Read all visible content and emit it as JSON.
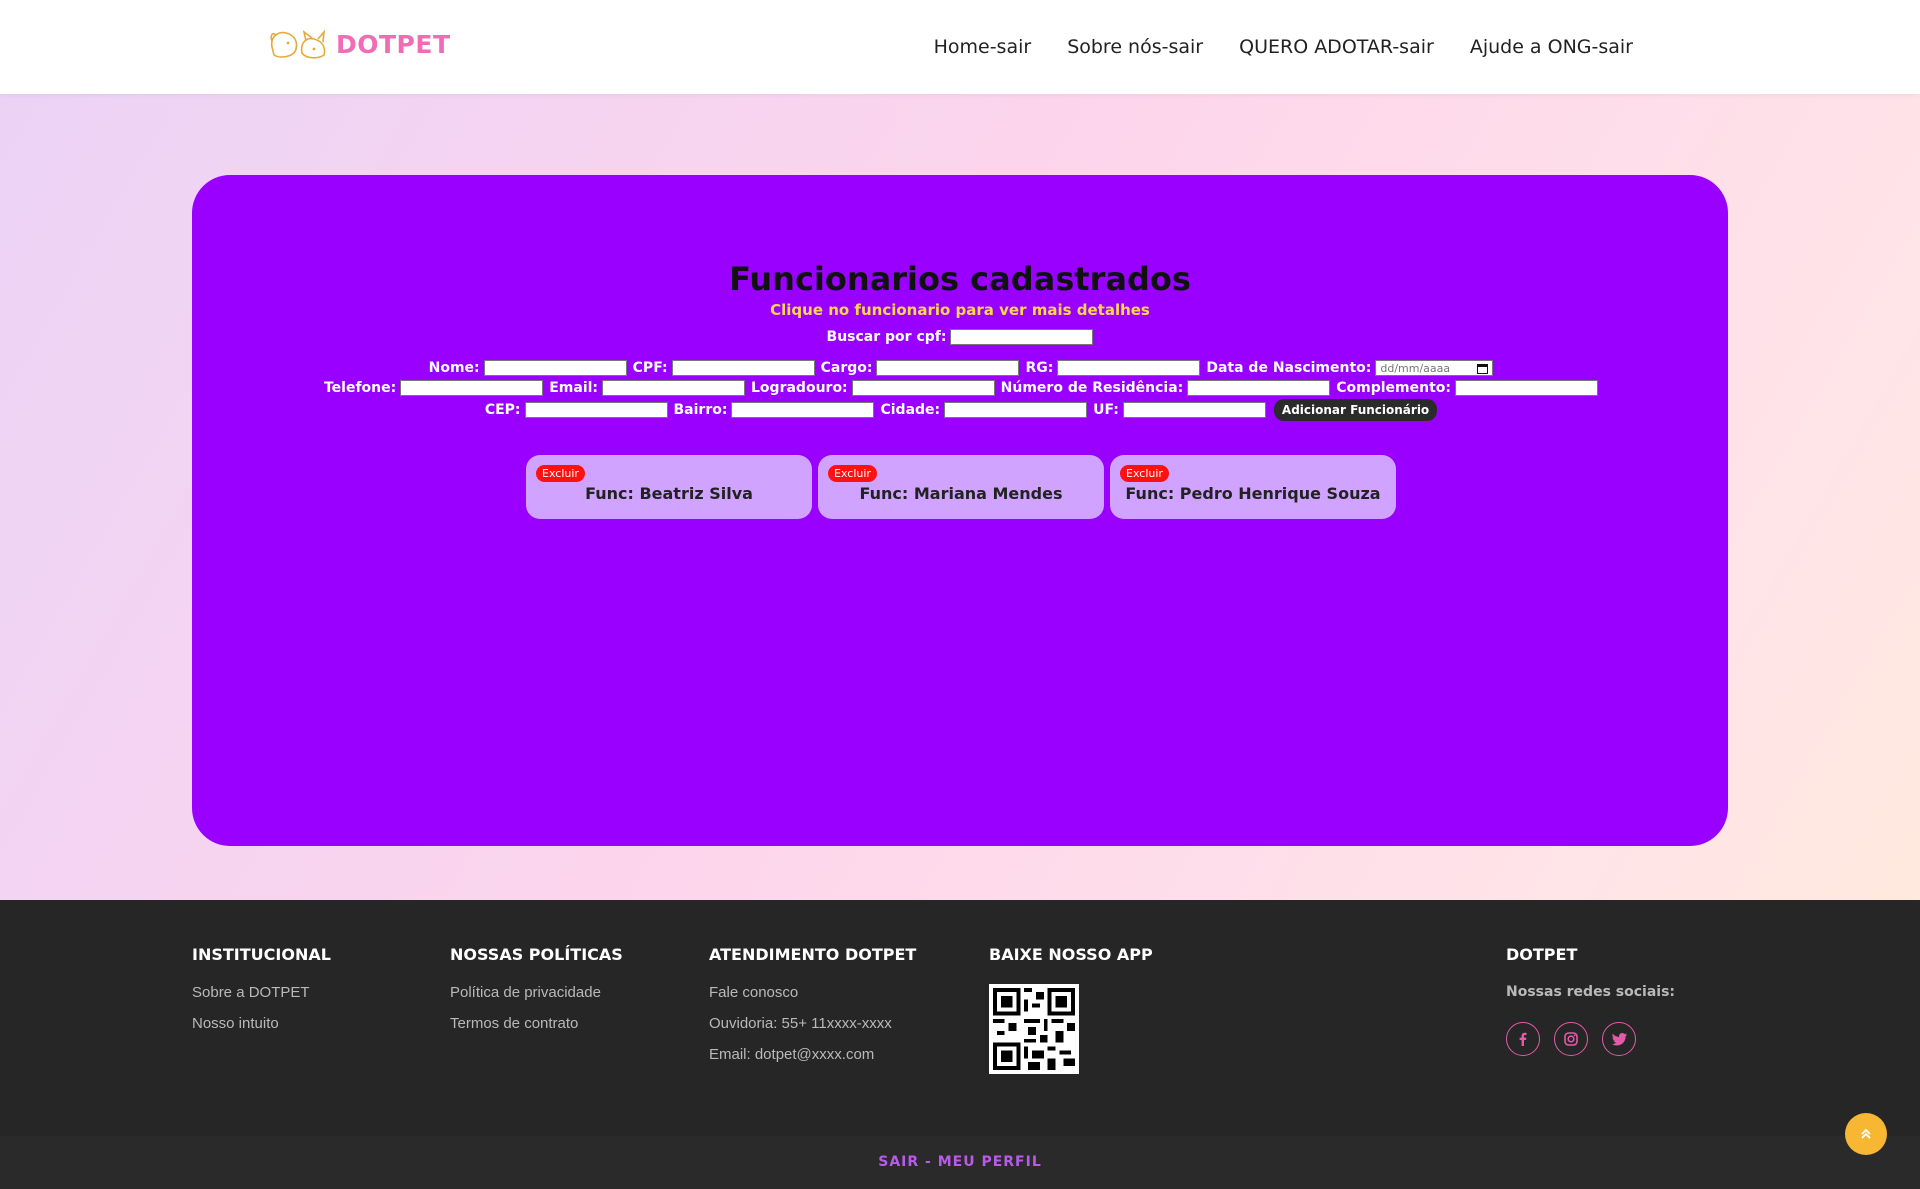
{
  "header": {
    "logo_text": "DOTPET",
    "nav": [
      "Home-sair",
      "Sobre nós-sair",
      "QUERO ADOTAR-sair",
      "Ajude a ONG-sair"
    ]
  },
  "main": {
    "title": "Funcionarios cadastrados",
    "subtitle": "Clique no funcionario para ver mais detalhes",
    "search_label": "Buscar por cpf:",
    "form": {
      "nome": "Nome:",
      "cpf": "CPF:",
      "cargo": "Cargo:",
      "rg": "RG:",
      "data_nascimento": "Data de Nascimento:",
      "date_placeholder": "dd/mm/aaaa",
      "telefone": "Telefone:",
      "email": "Email:",
      "logradouro": "Logradouro:",
      "numero": "Número de Residência:",
      "complemento": "Complemento:",
      "cep": "CEP:",
      "bairro": "Bairro:",
      "cidade": "Cidade:",
      "uf": "UF:",
      "add_button": "Adicionar Funcionário"
    },
    "employees": [
      {
        "name": "Func: Beatriz Silva",
        "delete_label": "Excluir"
      },
      {
        "name": "Func: Mariana Mendes",
        "delete_label": "Excluir"
      },
      {
        "name": "Func: Pedro Henrique Souza",
        "delete_label": "Excluir"
      }
    ]
  },
  "footer": {
    "institucional": {
      "title": "INSTITUCIONAL",
      "links": [
        "Sobre a DOTPET",
        "Nosso intuito"
      ]
    },
    "politicas": {
      "title": "NOSSAS POLÍTICAS",
      "links": [
        "Política de privacidade",
        "Termos de contrato"
      ]
    },
    "atendimento": {
      "title": "ATENDIMENTO DOTPET",
      "links": [
        "Fale conosco",
        "Ouvidoria: 55+ 11xxxx-xxxx",
        "Email: dotpet@xxxx.com"
      ]
    },
    "app": {
      "title": "BAIXE NOSSO APP"
    },
    "dotpet": {
      "title": "DOTPET",
      "social_label": "Nossas redes sociais:"
    },
    "bottom_link": "SAIR - MEU PERFIL"
  },
  "colors": {
    "panel": "#9a00ff",
    "card": "#cfa3ff",
    "accent": "#f06cb4",
    "subtitle": "#ffd84a",
    "delete": "#ff1111",
    "footer": "#262626"
  },
  "icons": [
    "dog-cat-logo-icon",
    "calendar-icon",
    "qr-code-icon",
    "facebook-icon",
    "instagram-icon",
    "twitter-icon",
    "chevron-up-icon"
  ]
}
